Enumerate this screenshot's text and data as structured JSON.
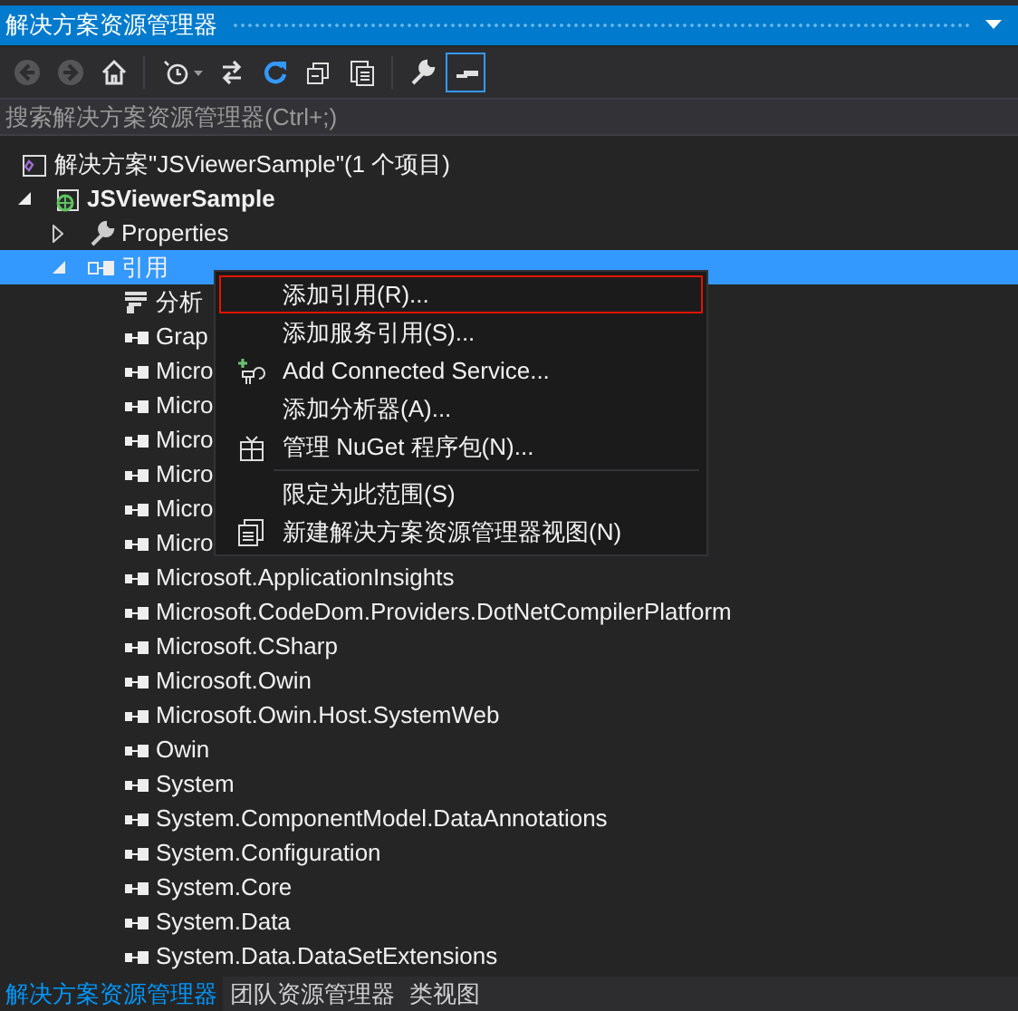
{
  "window": {
    "title": "解决方案资源管理器"
  },
  "toolbar": [
    {
      "kind": "back",
      "disabled": true,
      "selected": false
    },
    {
      "kind": "forward",
      "disabled": true,
      "selected": false
    },
    {
      "kind": "home",
      "disabled": false,
      "selected": false
    },
    {
      "kind": "history",
      "disabled": false,
      "selected": false
    },
    {
      "kind": "sync",
      "disabled": false,
      "selected": false
    },
    {
      "kind": "refresh",
      "disabled": false,
      "selected": false
    },
    {
      "kind": "collapse",
      "disabled": false,
      "selected": false
    },
    {
      "kind": "files",
      "disabled": false,
      "selected": false
    },
    {
      "kind": "wrench",
      "disabled": false,
      "selected": false
    },
    {
      "kind": "preview",
      "disabled": false,
      "selected": true
    }
  ],
  "search": {
    "placeholder": "搜索解决方案资源管理器(Ctrl+;)"
  },
  "tree": [
    {
      "label": "解决方案\"JSViewerSample\"(1 个项目)",
      "kind": "solution",
      "selected": false,
      "children": [
        {
          "label": "JSViewerSample",
          "kind": "project",
          "expanded": true,
          "selected": false,
          "children": [
            {
              "label": "Properties",
              "kind": "properties",
              "expanded": false,
              "selected": false
            },
            {
              "label": "引用",
              "kind": "references",
              "expanded": true,
              "selected": true,
              "children": [
                {
                  "label": "分析",
                  "kind": "analyzer",
                  "selected": false
                },
                {
                  "label": "Grap",
                  "kind": "reference",
                  "selected": false
                },
                {
                  "label": "Micro",
                  "kind": "reference",
                  "selected": false
                },
                {
                  "label": "Micro",
                  "kind": "reference",
                  "selected": false
                },
                {
                  "label": "Micro",
                  "kind": "reference",
                  "selected": false
                },
                {
                  "label": "Micro",
                  "kind": "reference",
                  "selected": false
                },
                {
                  "label": "Micro",
                  "kind": "reference",
                  "selected": false
                },
                {
                  "label": "Micro",
                  "kind": "reference",
                  "selected": false
                },
                {
                  "label": "Microsoft.ApplicationInsights",
                  "kind": "reference",
                  "selected": false
                },
                {
                  "label": "Microsoft.CodeDom.Providers.DotNetCompilerPlatform",
                  "kind": "reference",
                  "selected": false
                },
                {
                  "label": "Microsoft.CSharp",
                  "kind": "reference",
                  "selected": false
                },
                {
                  "label": "Microsoft.Owin",
                  "kind": "reference",
                  "selected": false
                },
                {
                  "label": "Microsoft.Owin.Host.SystemWeb",
                  "kind": "reference",
                  "selected": false
                },
                {
                  "label": "Owin",
                  "kind": "reference",
                  "selected": false
                },
                {
                  "label": "System",
                  "kind": "reference",
                  "selected": false
                },
                {
                  "label": "System.ComponentModel.DataAnnotations",
                  "kind": "reference",
                  "selected": false
                },
                {
                  "label": "System.Configuration",
                  "kind": "reference",
                  "selected": false
                },
                {
                  "label": "System.Core",
                  "kind": "reference",
                  "selected": false
                },
                {
                  "label": "System.Data",
                  "kind": "reference",
                  "selected": false
                },
                {
                  "label": "System.Data.DataSetExtensions",
                  "kind": "reference",
                  "selected": false
                }
              ]
            }
          ]
        }
      ]
    }
  ],
  "context_menu": [
    {
      "kind": "plain",
      "label": "添加引用(R)...",
      "selected": true
    },
    {
      "kind": "plain",
      "label": "添加服务引用(S)...",
      "selected": false
    },
    {
      "kind": "plug",
      "label": "Add Connected Service...",
      "selected": false
    },
    {
      "kind": "plain",
      "label": "添加分析器(A)...",
      "selected": false
    },
    {
      "kind": "package",
      "label": "管理 NuGet 程序包(N)...",
      "selected": false
    },
    {
      "kind": "separator"
    },
    {
      "kind": "plain",
      "label": "限定为此范围(S)",
      "selected": false
    },
    {
      "kind": "window",
      "label": "新建解决方案资源管理器视图(N)",
      "selected": false
    }
  ],
  "bottom_tabs": [
    {
      "label": "解决方案资源管理器",
      "selected": true
    },
    {
      "label": "团队资源管理器",
      "selected": false
    },
    {
      "label": "类视图",
      "selected": false
    }
  ]
}
